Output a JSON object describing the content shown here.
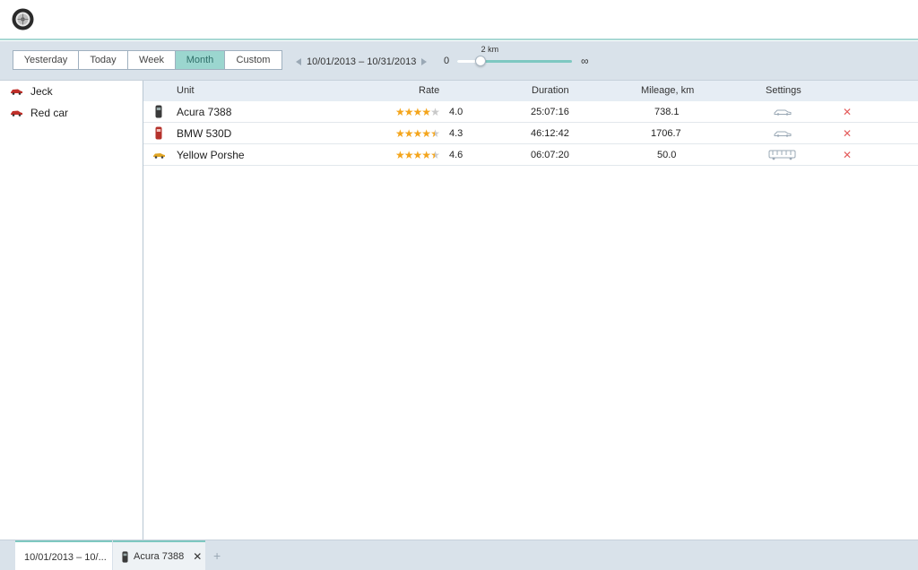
{
  "toolbar": {
    "periods": [
      "Yesterday",
      "Today",
      "Week",
      "Month",
      "Custom"
    ],
    "active_period": "Month",
    "date_range": "10/01/2013 – 10/31/2013",
    "slider": {
      "min_label": "0",
      "max_label": "∞",
      "value_label": "2 km",
      "level": 0.2
    }
  },
  "sidebar": {
    "units": [
      {
        "label": "Jeck",
        "icon": "red-car-icon"
      },
      {
        "label": "Red car",
        "icon": "red-car-icon"
      }
    ]
  },
  "table": {
    "headers": {
      "unit": "Unit",
      "rate": "Rate",
      "duration": "Duration",
      "mileage": "Mileage, km",
      "settings": "Settings"
    },
    "rows": [
      {
        "unit": "Acura 7388",
        "icon": "black-phone-car-icon",
        "rating": 4.0,
        "rate": "4.0",
        "duration": "25:07:16",
        "mileage": "738.1",
        "settings_icon": "sedan-icon",
        "delete": "✕"
      },
      {
        "unit": "BMW 530D",
        "icon": "red-phone-car-icon",
        "rating": 4.3,
        "rate": "4.3",
        "duration": "46:12:42",
        "mileage": "1706.7",
        "settings_icon": "sedan-icon",
        "delete": "✕"
      },
      {
        "unit": "Yellow Porshe",
        "icon": "yellow-car-icon",
        "rating": 4.6,
        "rate": "4.6",
        "duration": "06:07:20",
        "mileage": "50.0",
        "settings_icon": "bus-icon",
        "delete": "✕"
      }
    ]
  },
  "tabs": {
    "range_tab": "10/01/2013 – 10/...",
    "unit_tab": "Acura 7388",
    "close": "✕",
    "add": "+"
  },
  "colors": {
    "accent": "#9bd6cf",
    "star": "#f4a51c",
    "delete": "#e45b5b",
    "toolbar_bg": "#d9e2ea"
  }
}
